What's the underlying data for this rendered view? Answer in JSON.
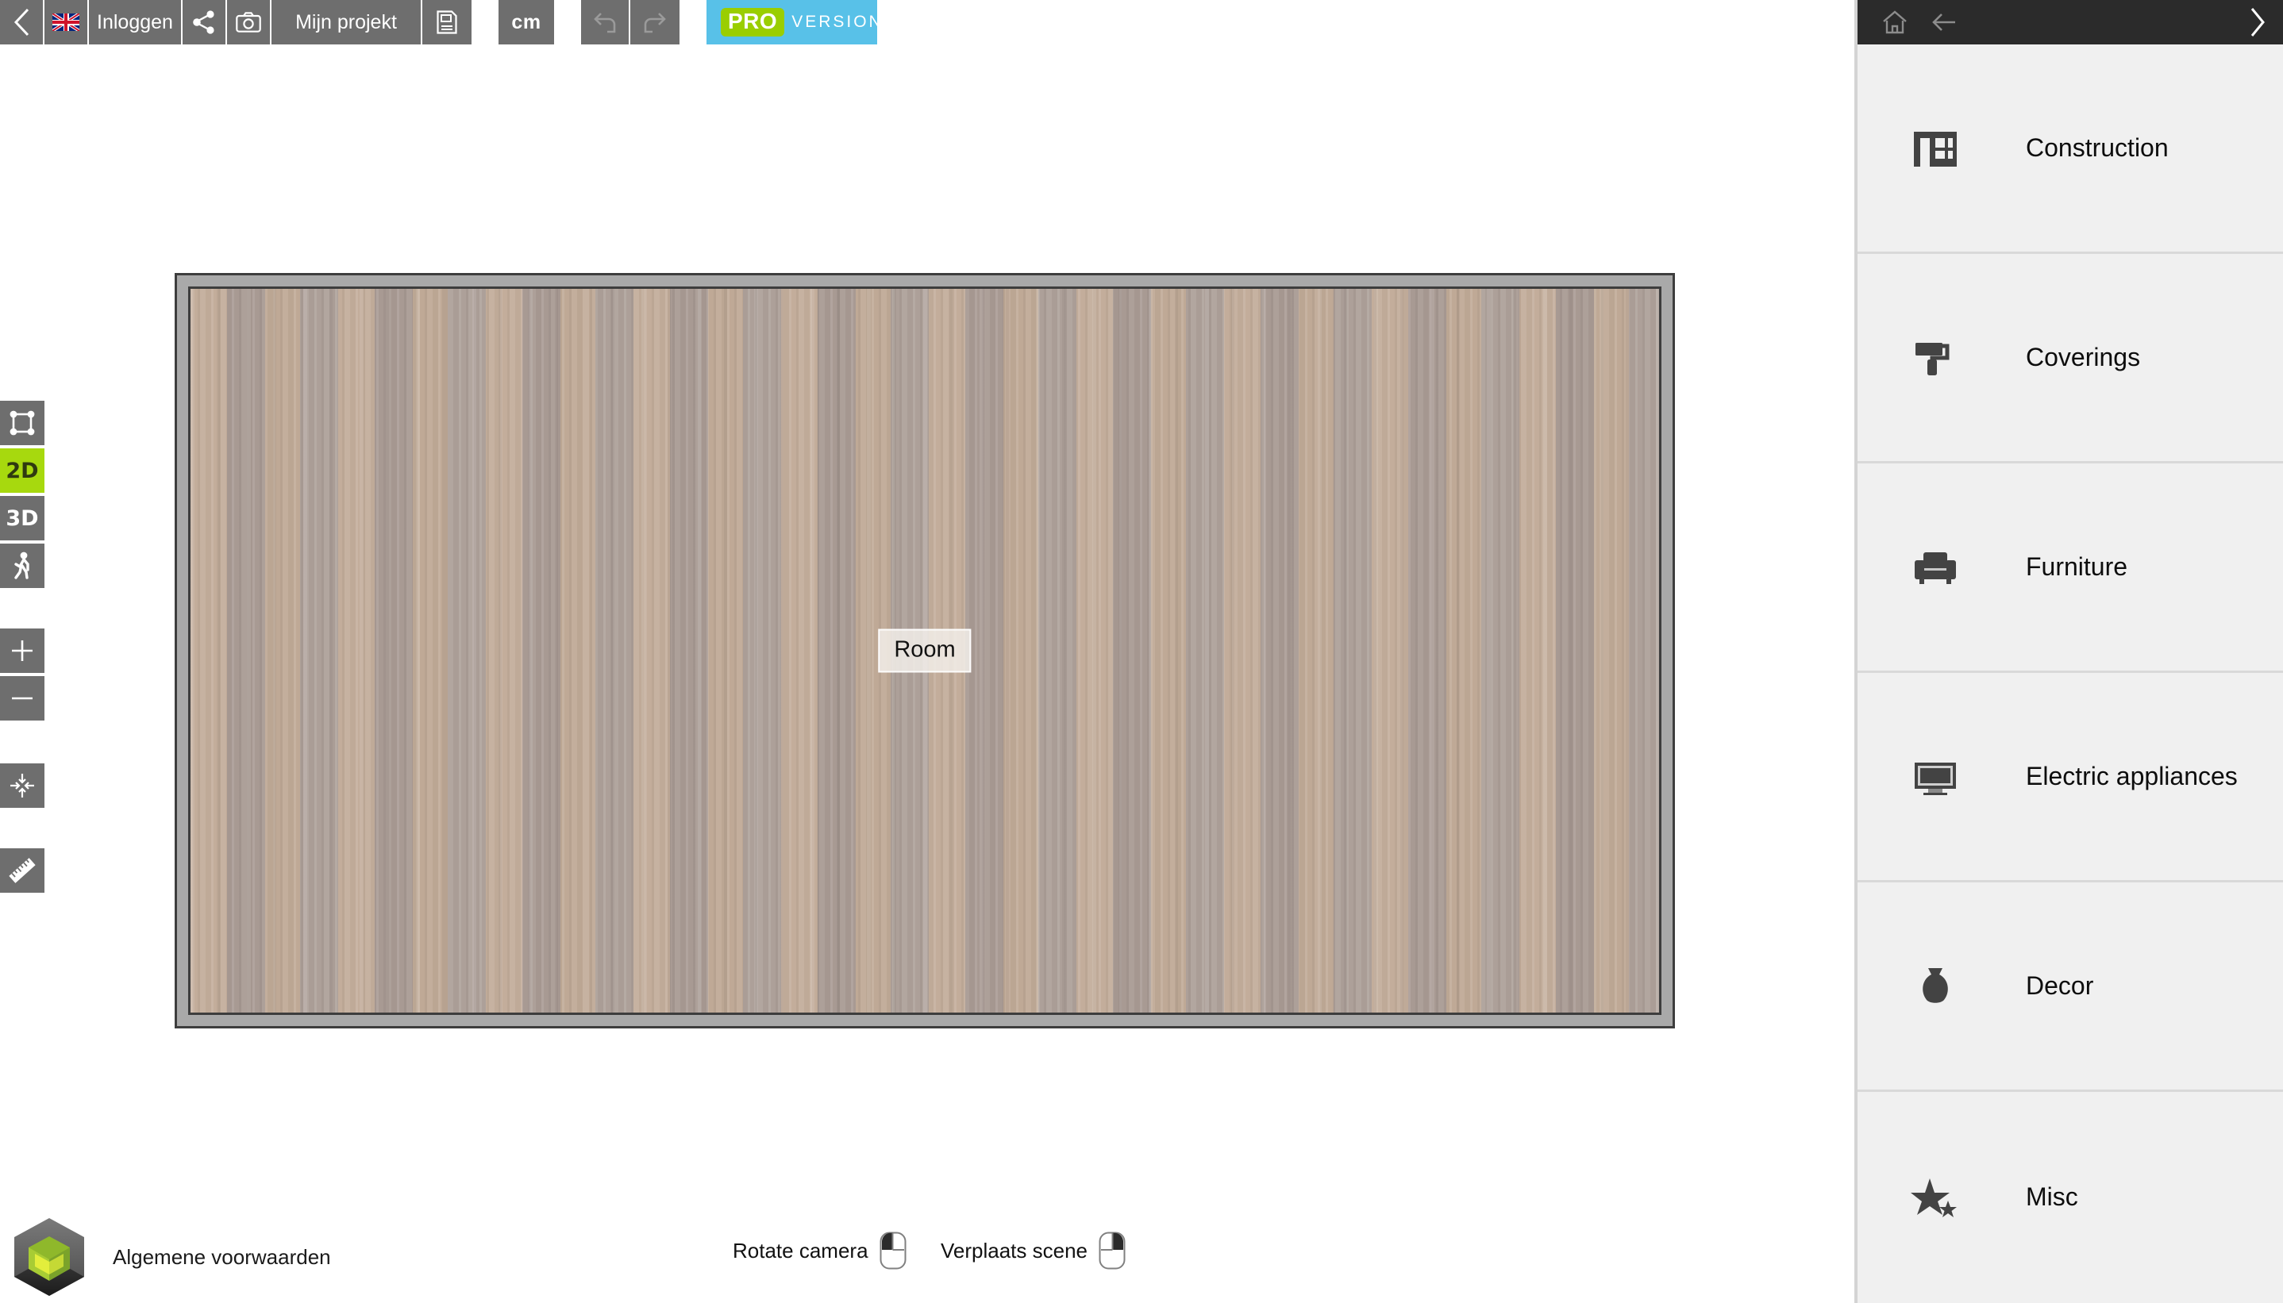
{
  "toolbar": {
    "back_label": "back",
    "language_icon": "uk-flag-icon",
    "login_label": "Inloggen",
    "share_icon": "share-icon",
    "camera_icon": "camera-icon",
    "project_label": "Mijn projekt",
    "save_icon": "floppy-disk-icon",
    "unit_label": "cm",
    "undo_icon": "undo-icon",
    "redo_icon": "redo-icon",
    "pro_chip": "PRO",
    "pro_word": "VERSION"
  },
  "left_tools": [
    {
      "name": "select-nodes",
      "icon": "square-nodes-icon",
      "label": "",
      "active": false
    },
    {
      "name": "view-2d",
      "icon": "text-2d",
      "label": "2D",
      "active": true
    },
    {
      "name": "view-3d",
      "icon": "text-3d",
      "label": "3D",
      "active": false
    },
    {
      "name": "walkthrough",
      "icon": "walking-person-icon",
      "label": "",
      "active": false
    },
    {
      "name": "zoom-in",
      "icon": "plus-icon",
      "label": "",
      "active": false
    },
    {
      "name": "zoom-out",
      "icon": "minus-icon",
      "label": "",
      "active": false
    },
    {
      "name": "fit-to-screen",
      "icon": "fit-arrows-icon",
      "label": "",
      "active": false
    },
    {
      "name": "measure",
      "icon": "ruler-icon",
      "label": "",
      "active": false
    }
  ],
  "canvas": {
    "room_label": "Room",
    "floor_material": "wood-planks",
    "wall_color": "#a9a9a9",
    "wall_outline_color": "#3d3d3d"
  },
  "bottom": {
    "logo_name": "hexagon-armchair-logo",
    "terms_label": "Algemene voorwaarden",
    "hints": [
      {
        "label": "Rotate camera",
        "icon": "mouse-left-button-icon",
        "button": "left"
      },
      {
        "label": "Verplaats scene",
        "icon": "mouse-right-button-icon",
        "button": "right"
      }
    ]
  },
  "right_panel": {
    "header": {
      "home_icon": "home-icon",
      "back_icon": "arrow-left-icon",
      "next_icon": "chevron-right-icon"
    },
    "categories": [
      {
        "label": "Construction",
        "icon": "wall-door-icon"
      },
      {
        "label": "Coverings",
        "icon": "paint-roller-icon"
      },
      {
        "label": "Furniture",
        "icon": "armchair-icon"
      },
      {
        "label": "Electric appliances",
        "icon": "television-icon"
      },
      {
        "label": "Decor",
        "icon": "vase-icon"
      },
      {
        "label": "Misc",
        "icon": "two-stars-icon"
      }
    ]
  },
  "colors": {
    "toolbar_bg": "#6e6e6e",
    "accent_green": "#a7d90e",
    "pro_blue": "#58c1e8",
    "panel_bg": "#f0f0f0",
    "panel_header_bg": "#2b2b2b"
  }
}
